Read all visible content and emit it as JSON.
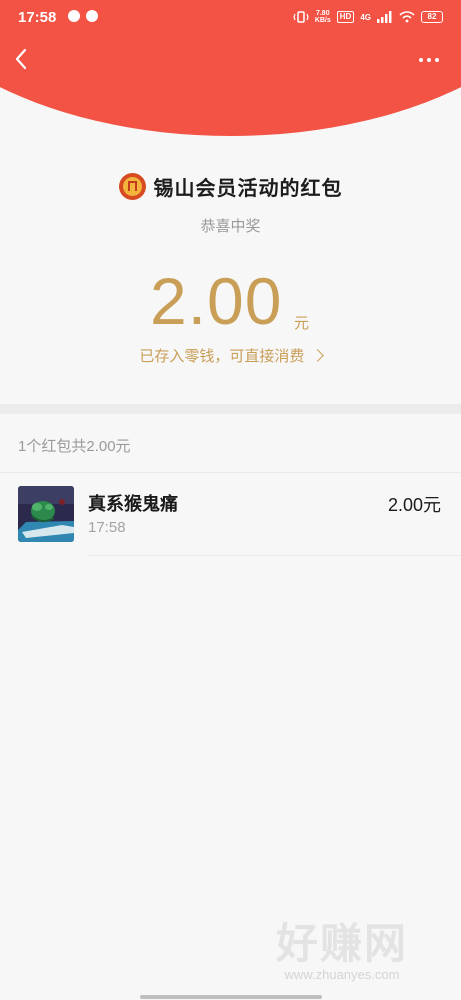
{
  "status_bar": {
    "time": "17:58",
    "network_speed": "7.80\nKB/s",
    "hd_label": "HD",
    "signal_label": "4G",
    "battery_level": "82"
  },
  "header": {
    "org_name": "锡山会员活动的红包",
    "subtitle": "恭喜中奖"
  },
  "amount": {
    "value": "2.00",
    "unit": "元",
    "wallet_text": "已存入零钱，可直接消费"
  },
  "summary": {
    "text": "1个红包共2.00元"
  },
  "recipient": {
    "name": "真系猴鬼痛",
    "time": "17:58",
    "amount": "2.00元"
  },
  "watermark": {
    "main": "好赚网",
    "sub": "www.zhuanyes.com"
  },
  "colors": {
    "header_red": "#f35345",
    "amount_gold": "#c99e57"
  },
  "icons": {
    "back": "chevron-left-icon",
    "more": "more-dots-icon",
    "org_logo": "union-logo-icon"
  }
}
